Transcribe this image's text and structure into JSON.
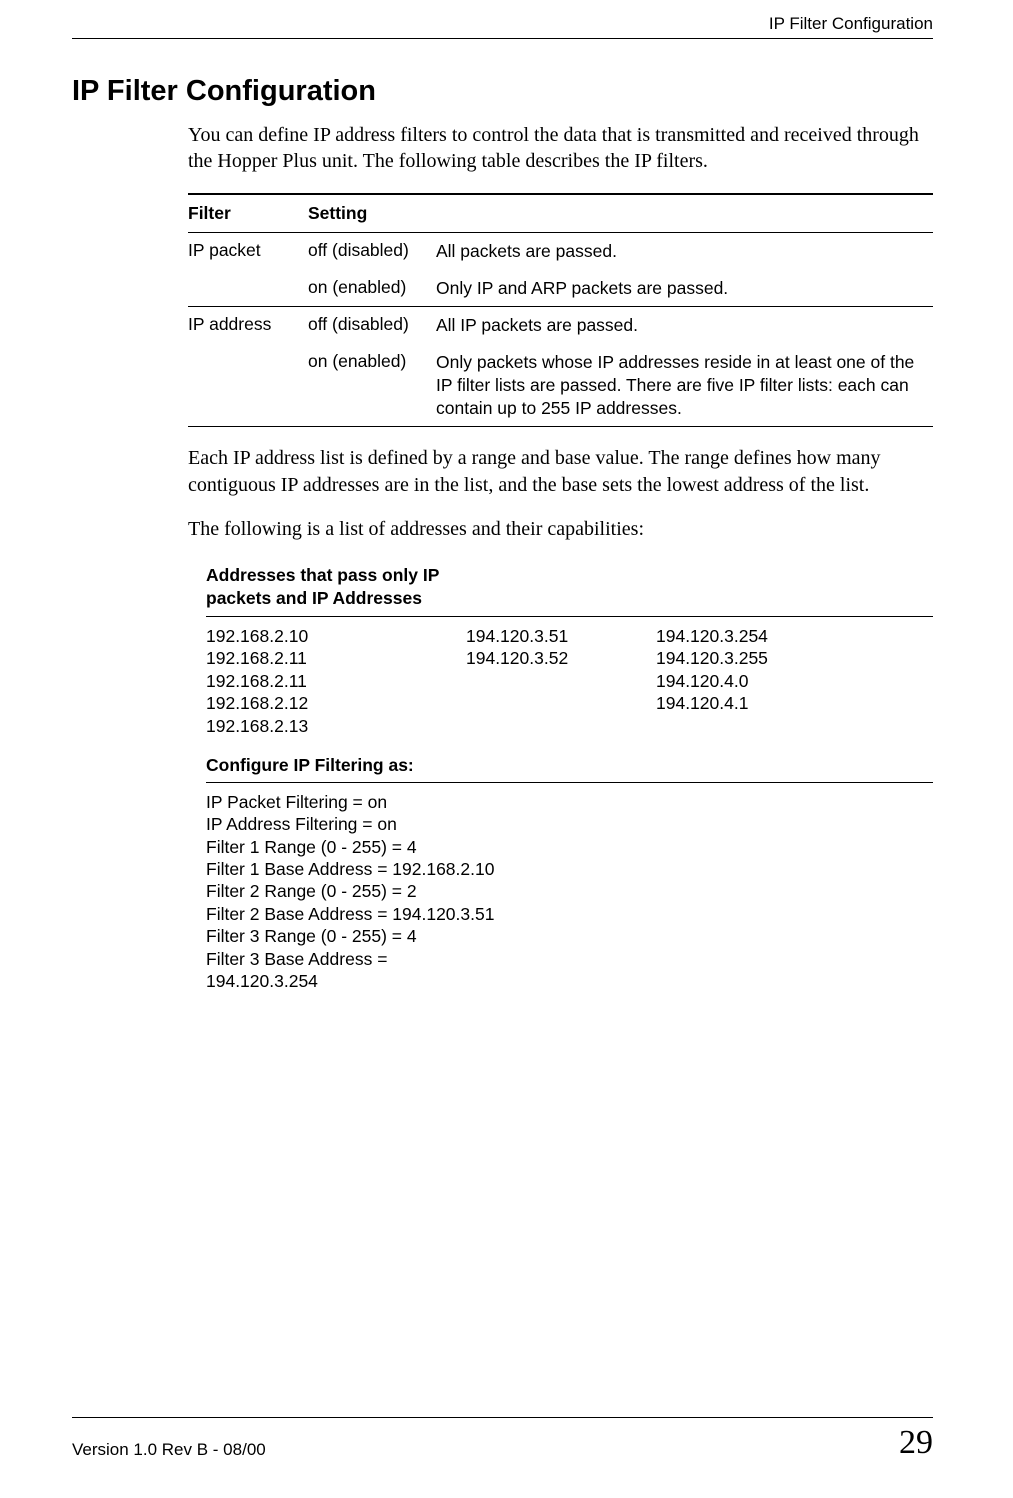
{
  "running_head": "IP Filter Configuration",
  "title": "IP Filter Configuration",
  "intro": "You can define IP address filters to control the data that is transmitted and received through the Hopper Plus unit. The following table describes the IP filters.",
  "filter_table": {
    "head_filter": "Filter",
    "head_setting": "Setting",
    "rows": [
      {
        "filter": "IP packet",
        "setting": "off (disabled)",
        "desc": "All packets are passed."
      },
      {
        "filter": "",
        "setting": "on (enabled)",
        "desc": "Only IP and ARP packets are passed."
      },
      {
        "filter": "IP address",
        "setting": "off (disabled)",
        "desc": "All IP packets are passed."
      },
      {
        "filter": "",
        "setting": "on (enabled)",
        "desc": "Only packets whose IP addresses reside in at least one of the IP filter lists are passed. There are five IP filter lists: each can contain up to 255 IP addresses."
      }
    ]
  },
  "after_table_1": "Each IP address list is defined by a range and base value. The range defines how many contiguous IP addresses are in the list, and the base sets the lowest address of the list.",
  "after_table_2": "The following is a list of addresses and their capabilities:",
  "addresses": {
    "heading_l1": "Addresses that pass only IP",
    "heading_l2": "packets and IP Addresses",
    "col1": [
      "192.168.2.10",
      "192.168.2.11",
      "192.168.2.11",
      "192.168.2.12",
      "192.168.2.13"
    ],
    "col2": [
      "194.120.3.51",
      "194.120.3.52"
    ],
    "col3": [
      "194.120.3.254",
      "194.120.3.255",
      "194.120.4.0",
      "194.120.4.1"
    ]
  },
  "configure": {
    "heading": "Configure IP Filtering as:",
    "lines": [
      "IP Packet Filtering = on",
      "IP Address Filtering = on",
      "Filter 1 Range (0 - 255) = 4",
      "Filter 1 Base Address = 192.168.2.10",
      "Filter 2 Range (0 - 255) = 2",
      "Filter 2 Base Address = 194.120.3.51",
      "Filter 3 Range (0 - 255) = 4",
      "Filter 3 Base Address =",
      "194.120.3.254"
    ]
  },
  "footer_version": "Version 1.0 Rev B - 08/00",
  "page_number": "29"
}
